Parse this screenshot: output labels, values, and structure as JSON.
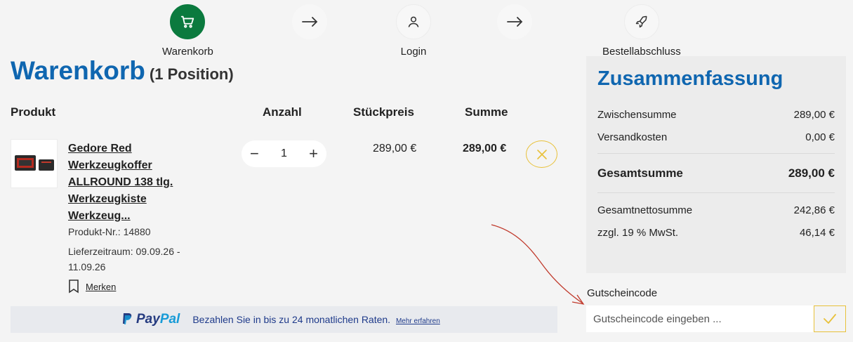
{
  "stepper": {
    "steps": [
      {
        "label": "Warenkorb",
        "icon": "cart-icon",
        "active": true
      },
      {
        "label": "Login",
        "icon": "user-icon",
        "active": false
      },
      {
        "label": "Bestellabschluss",
        "icon": "rocket-icon",
        "active": false
      }
    ]
  },
  "cart": {
    "title": "Warenkorb",
    "count": "(1 Position)",
    "headers": {
      "product": "Produkt",
      "quantity": "Anzahl",
      "unit_price": "Stückpreis",
      "sum": "Summe"
    },
    "item": {
      "name": "Gedore Red Werkzeugkoffer ALLROUND 138 tlg. Werkzeugkiste Werkzeug...",
      "product_no": "Produkt-Nr.: 14880",
      "delivery": "Lieferzeitraum: 09.09.26 - 11.09.26",
      "save_label": "Merken",
      "quantity": "1",
      "unit_price": "289,00 €",
      "sum": "289,00 €"
    }
  },
  "paypal": {
    "logo_pay": "Pay",
    "logo_pal": "Pal",
    "text": "Bezahlen Sie in bis zu 24 monatlichen Raten.",
    "link": "Mehr erfahren"
  },
  "summary": {
    "title": "Zusammenfassung",
    "subtotal_label": "Zwischensumme",
    "subtotal": "289,00 €",
    "shipping_label": "Versandkosten",
    "shipping": "0,00 €",
    "total_label": "Gesamtsumme",
    "total": "289,00 €",
    "net_label": "Gesamtnettosumme",
    "net": "242,86 €",
    "vat_label": "zzgl. 19 % MwSt.",
    "vat": "46,14 €"
  },
  "coupon": {
    "label": "Gutscheincode",
    "placeholder": "Gutscheincode eingeben ..."
  },
  "colors": {
    "brand_blue": "#0f66b0",
    "active_step": "#0b7a3e",
    "accent_yellow": "#e8c13a"
  }
}
